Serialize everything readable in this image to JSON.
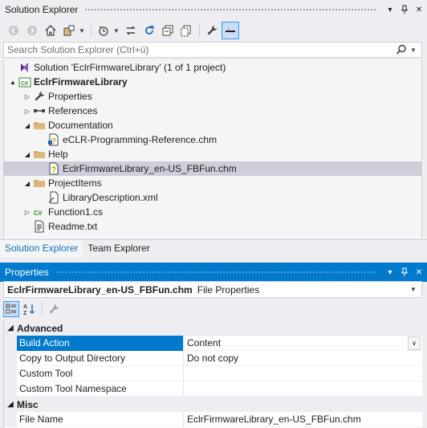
{
  "solution_explorer": {
    "title": "Solution Explorer",
    "title_buttons": [
      "▾",
      "⊥",
      "✕"
    ],
    "search_placeholder": "Search Solution Explorer (Ctrl+ü)",
    "tree": [
      {
        "label": "Solution 'EclrFirmwareLibrary' (1 of 1 project)",
        "level": 0,
        "expander": "",
        "icon": "solution-icon",
        "bold": false
      },
      {
        "label": "EclrFirmwareLibrary",
        "level": 0,
        "expander": "▲",
        "icon": "csharp-project-icon",
        "bold": true
      },
      {
        "label": "Properties",
        "level": 1,
        "expander": "▷",
        "icon": "wrench-icon",
        "bold": false
      },
      {
        "label": "References",
        "level": 1,
        "expander": "▷",
        "icon": "references-icon",
        "bold": false
      },
      {
        "label": "Documentation",
        "level": 1,
        "expander": "◢",
        "icon": "folder-icon",
        "bold": false
      },
      {
        "label": "eCLR-Programming-Reference.chm",
        "level": 2,
        "expander": "",
        "icon": "chm-file-icon",
        "bold": false
      },
      {
        "label": "Help",
        "level": 1,
        "expander": "◢",
        "icon": "folder-icon",
        "bold": false
      },
      {
        "label": "EclrFirmwareLibrary_en-US_FBFun.chm",
        "level": 2,
        "expander": "",
        "icon": "chm-help-icon",
        "bold": false,
        "selected": true
      },
      {
        "label": "ProjectItems",
        "level": 1,
        "expander": "◢",
        "icon": "folder-icon",
        "bold": false
      },
      {
        "label": "LibraryDescription.xml",
        "level": 2,
        "expander": "",
        "icon": "xml-file-icon",
        "bold": false
      },
      {
        "label": "Function1.cs",
        "level": 1,
        "expander": "▷",
        "icon": "csharp-file-icon",
        "bold": false
      },
      {
        "label": "Readme.txt",
        "level": 1,
        "expander": "",
        "icon": "text-file-icon",
        "bold": false
      }
    ],
    "tabs": [
      "Solution Explorer",
      "Team Explorer"
    ],
    "active_tab": 0
  },
  "properties": {
    "title": "Properties",
    "title_buttons": [
      "▾",
      "⊥",
      "✕"
    ],
    "object_name": "EclrFirmwareLibrary_en-US_FBFun.chm",
    "object_type": "File Properties",
    "categories": [
      {
        "name": "Advanced",
        "expander": "◢",
        "rows": [
          {
            "name": "Build Action",
            "value": "Content",
            "selected": true
          },
          {
            "name": "Copy to Output Directory",
            "value": "Do not copy"
          },
          {
            "name": "Custom Tool",
            "value": ""
          },
          {
            "name": "Custom Tool Namespace",
            "value": ""
          }
        ]
      },
      {
        "name": "Misc",
        "expander": "◢",
        "rows": [
          {
            "name": "File Name",
            "value": "EclrFirmwareLibrary_en-US_FBFun.chm"
          }
        ]
      }
    ]
  },
  "colors": {
    "accent": "#007acc",
    "selection": "#cccedb",
    "background": "#eeeef2"
  }
}
